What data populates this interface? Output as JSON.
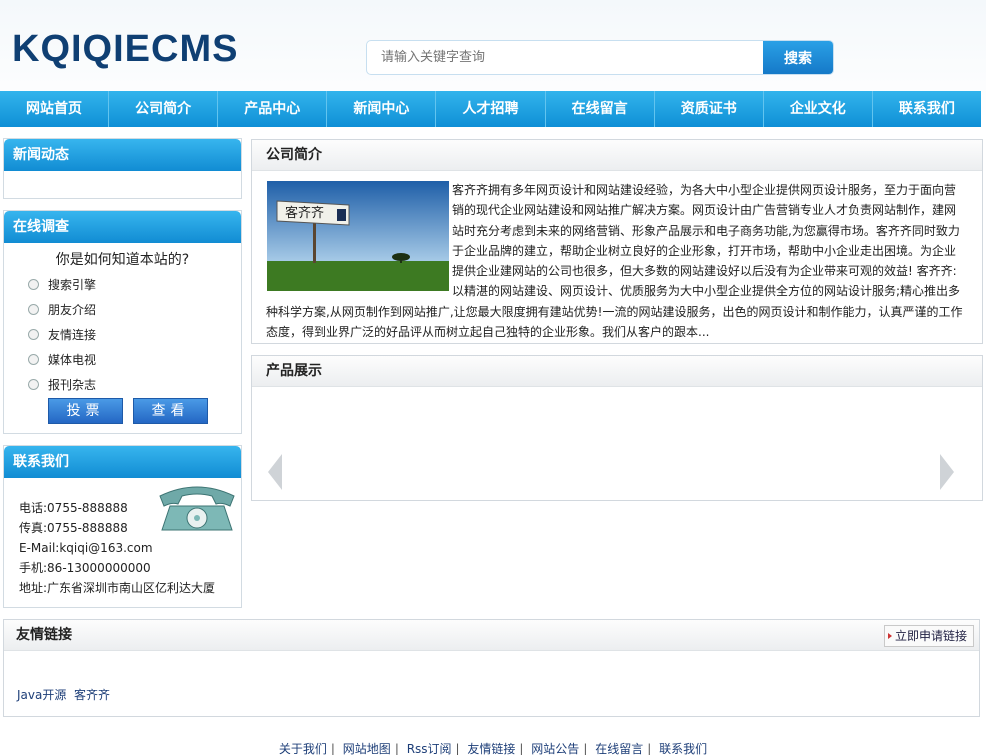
{
  "header": {
    "logo": "KQIQIECMS",
    "search_placeholder": "请输入关键字查询",
    "search_button": "搜索"
  },
  "nav": [
    "网站首页",
    "公司简介",
    "产品中心",
    "新闻中心",
    "人才招聘",
    "在线留言",
    "资质证书",
    "企业文化",
    "联系我们"
  ],
  "sidebar": {
    "news": {
      "title": "新闻动态"
    },
    "poll": {
      "title": "在线调查",
      "question": "你是如何知道本站的?",
      "options": [
        "搜索引擎",
        "朋友介绍",
        "友情连接",
        "媒体电视",
        "报刊杂志"
      ],
      "vote_button": "投票",
      "view_button": "查看"
    },
    "contact": {
      "title": "联系我们",
      "phone": "电话:0755-888888",
      "fax": "传真:0755-888888",
      "email": "E-Mail:kqiqi@163.com",
      "mobile": "手机:86-13000000000",
      "address": "地址:广东省深圳市南山区亿利达大厦"
    }
  },
  "intro": {
    "title": "公司简介",
    "sign_text": "客齐齐",
    "text": "客齐齐拥有多年网页设计和网站建设经验，为各大中小型企业提供网页设计服务，至力于面向营销的现代企业网站建设和网站推广解决方案。网页设计由广告营销专业人才负责网站制作，建网站时充分考虑到未来的网络营销、形象产品展示和电子商务功能,为您赢得市场。客齐齐同时致力于企业品牌的建立，帮助企业树立良好的企业形象，打开市场，帮助中小企业走出困境。为企业提供企业建网站的公司也很多，但大多数的网站建设好以后没有为企业带来可观的效益! 客齐齐:以精湛的网站建设、网页设计、优质服务为大中小型企业提供全方位的网站设计服务;精心推出多种科学方案,从网页制作到网站推广,让您最大限度拥有建站优势!一流的网站建设服务，出色的网页设计和制作能力，认真严谨的工作态度，得到业界广泛的好品评从而树立起自己独特的企业形象。我们从客户的跟本..."
  },
  "products": {
    "title": "产品展示"
  },
  "links": {
    "title": "友情链接",
    "apply": "立即申请链接",
    "items": [
      "Java开源",
      "客齐齐"
    ]
  },
  "footer": [
    "关于我们",
    "网站地图",
    "Rss订阅",
    "友情链接",
    "网站公告",
    "在线留言",
    "联系我们"
  ],
  "colors": {
    "nav_blue": "#1a9ee0",
    "logo": "#0f3f73",
    "link": "#1d3e78"
  }
}
